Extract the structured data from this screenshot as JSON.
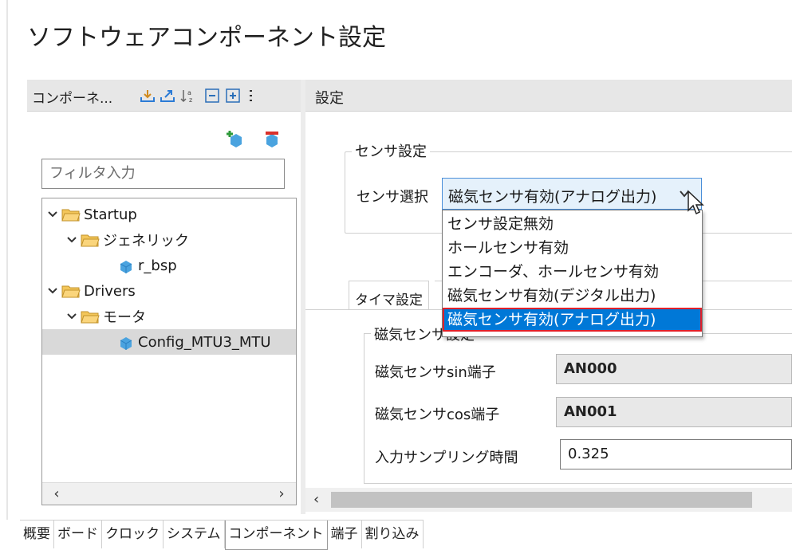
{
  "title": "ソフトウェアコンポーネント設定",
  "left_panel": {
    "title": "コンポーネ...",
    "filter_placeholder": "フィルタ入力",
    "tree": [
      {
        "label": "Startup"
      },
      {
        "label": "ジェネリック"
      },
      {
        "label": "r_bsp"
      },
      {
        "label": "Drivers"
      },
      {
        "label": "モータ"
      },
      {
        "label": "Config_MTU3_MTU"
      }
    ]
  },
  "right_panel": {
    "title": "設定",
    "sensor_group_label": "センサ設定",
    "sensor_select_label": "センサ選択",
    "sensor_select_value": "磁気センサ有効(アナログ出力)",
    "dropdown_options": [
      "センサ設定無効",
      "ホールセンサ有効",
      "エンコーダ、ホールセンサ有効",
      "磁気センサ有効(デジタル出力)",
      "磁気センサ有効(アナログ出力)"
    ],
    "tab_label": "タイマ設定",
    "mag_group_label": "磁気センサ設定",
    "sin_label": "磁気センサsin端子",
    "sin_value": "AN000",
    "cos_label": "磁気センサcos端子",
    "cos_value": "AN001",
    "sampling_label": "入力サンプリング時間",
    "sampling_value": "0.325"
  },
  "bottom_tabs": [
    "概要",
    "ボード",
    "クロック",
    "システム",
    "コンポーネント",
    "端子",
    "割り込み"
  ],
  "active_bottom_tab": "コンポーネント",
  "colors": {
    "accent": "#0078d7",
    "highlight_border": "#e0202a",
    "combo_bg": "#e5f1fb"
  }
}
